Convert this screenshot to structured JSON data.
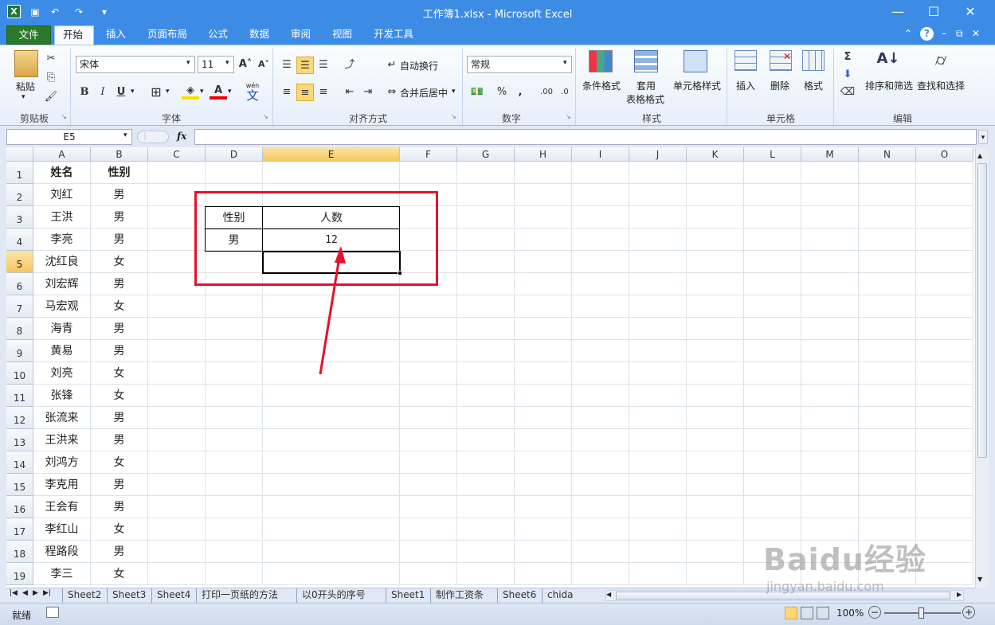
{
  "window": {
    "title": "工作簿1.xlsx  -  Microsoft Excel",
    "app_icon": "excel-icon"
  },
  "tabs": [
    "文件",
    "开始",
    "插入",
    "页面布局",
    "公式",
    "数据",
    "审阅",
    "视图",
    "开发工具"
  ],
  "active_tab": "开始",
  "ribbon": {
    "clipboard": {
      "paste_label": "粘贴",
      "group": "剪贴板"
    },
    "font": {
      "name": "宋体",
      "size": "11",
      "group": "字体",
      "bold": "B",
      "italic": "I",
      "underline": "U",
      "grow": "A˄",
      "shrink": "A˅",
      "font_color_icon": "A",
      "phonetic": "wén"
    },
    "alignment": {
      "wrap": "自动换行",
      "merge": "合并后居中",
      "group": "对齐方式"
    },
    "number": {
      "format": "常规",
      "group": "数字",
      "percent": "%",
      "comma": ","
    },
    "styles": {
      "cond": "条件格式",
      "table1": "套用",
      "table2": "表格格式",
      "cellstyle": "单元格样式",
      "group": "样式"
    },
    "cells": {
      "insert": "插入",
      "delete": "删除",
      "format": "格式",
      "group": "单元格"
    },
    "editing": {
      "sort": "排序和筛选",
      "find": "查找和选择",
      "group": "编辑",
      "sum": "Σ"
    }
  },
  "formula_bar": {
    "name_box": "E5",
    "fx": "fx",
    "value": ""
  },
  "columns": [
    "A",
    "B",
    "C",
    "D",
    "E",
    "F",
    "G",
    "H",
    "I",
    "J",
    "K",
    "L",
    "M",
    "N",
    "O"
  ],
  "rows": [
    "1",
    "2",
    "3",
    "4",
    "5",
    "6",
    "7",
    "8",
    "9",
    "10",
    "11",
    "12",
    "13",
    "14",
    "15",
    "16",
    "17",
    "18",
    "19"
  ],
  "selected": {
    "col": "E",
    "row": "5"
  },
  "col_a": [
    "姓名",
    "刘红",
    "王洪",
    "李亮",
    "沈红良",
    "刘宏辉",
    "马宏观",
    "海青",
    "黄易",
    "刘亮",
    "张锋",
    "张流来",
    "王洪来",
    "刘鸿方",
    "李克用",
    "王会有",
    "李红山",
    "程路段",
    "李三"
  ],
  "col_b": [
    "性别",
    "男",
    "男",
    "男",
    "女",
    "男",
    "女",
    "男",
    "男",
    "女",
    "女",
    "男",
    "男",
    "女",
    "男",
    "男",
    "女",
    "男",
    "女"
  ],
  "summary": {
    "h1": "性别",
    "h2": "人数",
    "v1": "男",
    "v2": "12"
  },
  "sheets": [
    "Sheet2",
    "Sheet3",
    "Sheet4",
    "打印一页纸的方法",
    "以0开头的序号",
    "Sheet1",
    "制作工资条",
    "Sheet6",
    "chida"
  ],
  "status": {
    "ready": "就绪",
    "zoom": "100%"
  },
  "colors": {
    "title_blue": "#3c8ce6",
    "file_green": "#2b7a2b",
    "annotation_red": "#e8102a",
    "selection": "#f5c75e"
  },
  "watermark": {
    "brand": "Baidu经验",
    "url": "jingyan.baidu.com"
  }
}
